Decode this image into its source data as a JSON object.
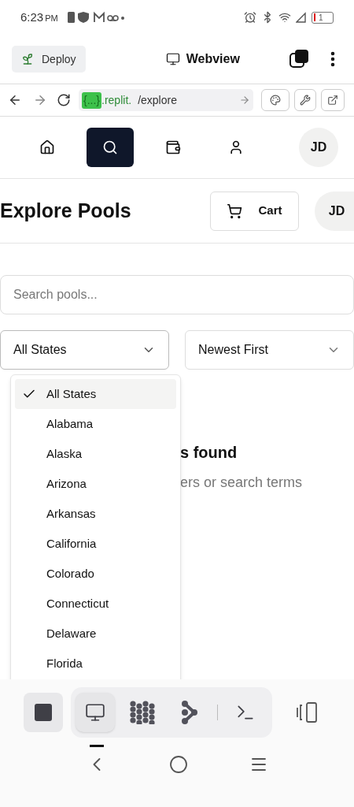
{
  "status_bar": {
    "time": "6:23",
    "ampm": "PM",
    "battery": "1"
  },
  "ide_header": {
    "deploy": "Deploy",
    "title": "Webview"
  },
  "url_bar": {
    "prefix": "{...}",
    "domain": ".replit.",
    "path": "/explore"
  },
  "app_nav": {
    "tabs": [
      {
        "kind": "home",
        "selected": false
      },
      {
        "kind": "search",
        "selected": true
      },
      {
        "kind": "wallet",
        "selected": false
      },
      {
        "kind": "user",
        "selected": false
      }
    ],
    "avatar": "JD"
  },
  "page_header": {
    "title": "Explore Pools",
    "cart": "Cart",
    "avatar": "JD"
  },
  "search": {
    "placeholder": "Search pools..."
  },
  "filters": [
    {
      "value": "All States",
      "expanded": true
    },
    {
      "value": "Newest First",
      "expanded": false
    }
  ],
  "state_options": [
    {
      "label": "All States",
      "selected": true
    },
    {
      "label": "Alabama",
      "selected": false
    },
    {
      "label": "Alaska",
      "selected": false
    },
    {
      "label": "Arizona",
      "selected": false
    },
    {
      "label": "Arkansas",
      "selected": false
    },
    {
      "label": "California",
      "selected": false
    },
    {
      "label": "Colorado",
      "selected": false
    },
    {
      "label": "Connecticut",
      "selected": false
    },
    {
      "label": "Delaware",
      "selected": false
    },
    {
      "label": "Florida",
      "selected": false
    }
  ],
  "empty_state": {
    "heading": "s found",
    "hint": "ers or search terms"
  },
  "tool_bar": {
    "tools": [
      {
        "kind": "preview",
        "selected": true
      },
      {
        "kind": "packages",
        "selected": false
      },
      {
        "kind": "git",
        "selected": false
      },
      {
        "kind": "shell",
        "selected": false
      }
    ]
  }
}
